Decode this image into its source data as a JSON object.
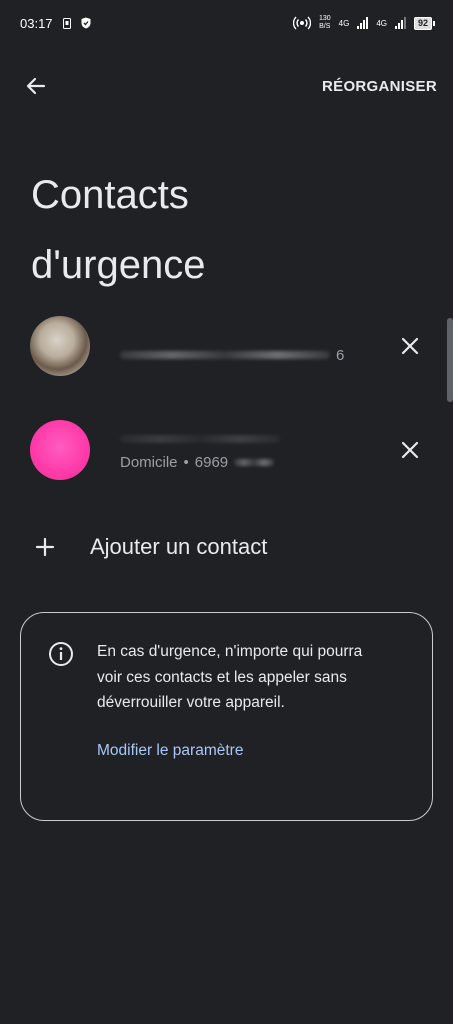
{
  "status_bar": {
    "time": "03:17",
    "net_speed_value": "130",
    "net_speed_unit": "B/S",
    "network_1": "4G",
    "network_2": "4G",
    "battery": "92"
  },
  "topbar": {
    "reorganize_label": "RÉORGANISER"
  },
  "page": {
    "title_line1": "Contacts",
    "title_line2": "d'urgence"
  },
  "contacts": [
    {
      "avatar": "photo",
      "detail_suffix": "6"
    },
    {
      "avatar": "pink-circle",
      "label": "Domicile",
      "separator": "•",
      "number_partial": "6969"
    }
  ],
  "add_contact": {
    "label": "Ajouter un contact"
  },
  "info_card": {
    "text": "En cas d'urgence, n'importe qui pourra voir ces contacts et les appeler sans déverrouiller votre appareil.",
    "link_label": "Modifier le paramètre"
  },
  "colors": {
    "background": "#202124",
    "text": "#e8eaed",
    "secondary_text": "#9aa0a6",
    "link": "#a8c7fa",
    "avatar_pink": "#ff3aa8"
  }
}
